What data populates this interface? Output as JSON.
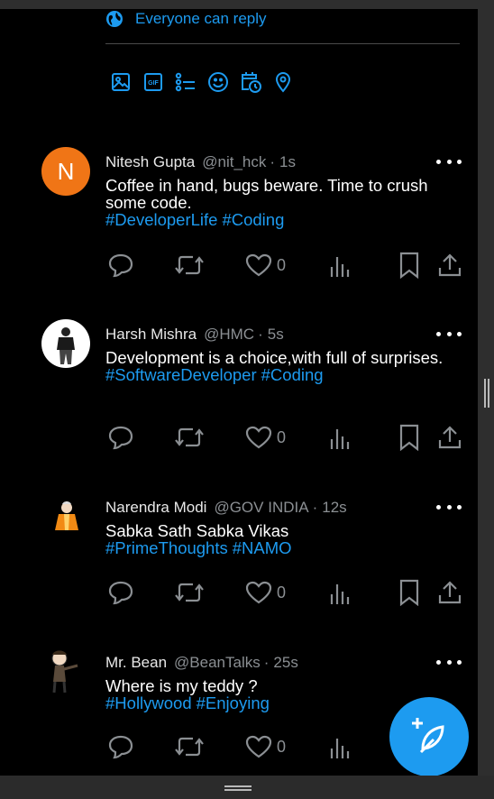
{
  "compose": {
    "reply_setting": "Everyone can reply",
    "tools": [
      "image-icon",
      "gif-icon",
      "poll-icon",
      "emoji-icon",
      "schedule-icon",
      "location-icon"
    ]
  },
  "posts": [
    {
      "avatar_letter": "N",
      "avatar_color": "#f07516",
      "name": "Nitesh Gupta",
      "handle": "@nit_hck",
      "time": "1s",
      "text": "Coffee in hand, bugs beware. Time to crush some code.",
      "tags": [
        "#DeveloperLife",
        "#Coding"
      ],
      "likes": "0"
    },
    {
      "name": "Harsh Mishra",
      "handle": "@HMC",
      "time": "5s",
      "text": "Development is a choice,with full of surprises.",
      "tags": [
        "#SoftwareDeveloper",
        "#Coding"
      ],
      "likes": "0"
    },
    {
      "name": "Narendra Modi",
      "handle": "@GOV INDIA",
      "time": "12s",
      "text": "Sabka Sath Sabka Vikas",
      "tags": [
        "#PrimeThoughts",
        "#NAMO"
      ],
      "likes": "0"
    },
    {
      "name": "Mr. Bean",
      "handle": "@BeanTalks",
      "time": "25s",
      "text": "Where is my teddy ?",
      "tags": [
        "#Hollywood",
        "#Enjoying"
      ],
      "likes": "0"
    }
  ],
  "colors": {
    "accent": "#1d9bf0",
    "muted": "#8b8f93",
    "background": "#000000"
  }
}
